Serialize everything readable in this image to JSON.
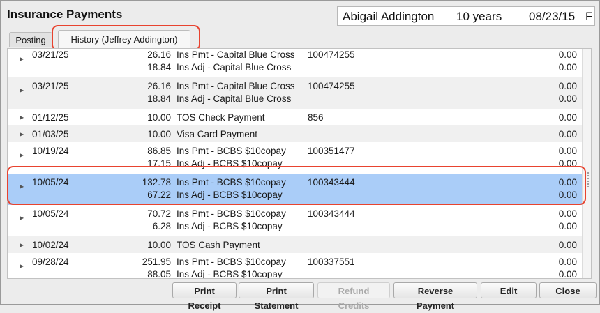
{
  "window": {
    "title": "Insurance Payments"
  },
  "patient": {
    "name": "Abigail Addington",
    "age": "10 years",
    "dob": "08/23/15",
    "sex": "F"
  },
  "tabs": [
    {
      "label": "Posting"
    },
    {
      "label": "History (Jeffrey Addington)"
    }
  ],
  "rows": [
    {
      "date": "03/21/25",
      "lines": [
        {
          "amount": "26.16",
          "desc": "Ins Pmt - Capital Blue Cross",
          "balance": "0.00"
        },
        {
          "amount": "18.84",
          "desc": "Ins Adj - Capital Blue Cross",
          "balance": "0.00"
        }
      ],
      "ref": "100474255"
    },
    {
      "date": "03/21/25",
      "lines": [
        {
          "amount": "26.16",
          "desc": "Ins Pmt - Capital Blue Cross",
          "balance": "0.00"
        },
        {
          "amount": "18.84",
          "desc": "Ins Adj - Capital Blue Cross",
          "balance": "0.00"
        }
      ],
      "ref": "100474255"
    },
    {
      "date": "01/12/25",
      "lines": [
        {
          "amount": "10.00",
          "desc": "TOS Check Payment",
          "balance": "0.00"
        }
      ],
      "ref": "856"
    },
    {
      "date": "01/03/25",
      "lines": [
        {
          "amount": "10.00",
          "desc": "Visa Card Payment",
          "balance": "0.00"
        }
      ],
      "ref": ""
    },
    {
      "date": "10/19/24",
      "lines": [
        {
          "amount": "86.85",
          "desc": "Ins Pmt - BCBS $10copay",
          "balance": "0.00"
        },
        {
          "amount": "17.15",
          "desc": "Ins Adj - BCBS $10copay",
          "balance": "0.00"
        }
      ],
      "ref": "100351477"
    },
    {
      "date": "10/05/24",
      "lines": [
        {
          "amount": "132.78",
          "desc": "Ins Pmt - BCBS $10copay",
          "balance": "0.00"
        },
        {
          "amount": "67.22",
          "desc": "Ins Adj - BCBS $10copay",
          "balance": "0.00"
        }
      ],
      "ref": "100343444",
      "selected": true
    },
    {
      "date": "10/05/24",
      "lines": [
        {
          "amount": "70.72",
          "desc": "Ins Pmt - BCBS $10copay",
          "balance": "0.00"
        },
        {
          "amount": "6.28",
          "desc": "Ins Adj - BCBS $10copay",
          "balance": "0.00"
        }
      ],
      "ref": "100343444"
    },
    {
      "date": "10/02/24",
      "lines": [
        {
          "amount": "10.00",
          "desc": "TOS Cash Payment",
          "balance": "0.00"
        }
      ],
      "ref": ""
    },
    {
      "date": "09/28/24",
      "lines": [
        {
          "amount": "251.95",
          "desc": "Ins Pmt - BCBS $10copay",
          "balance": "0.00"
        },
        {
          "amount": "88.05",
          "desc": "Ins Adj - BCBS $10copay",
          "balance": "0.00"
        }
      ],
      "ref": "100337551"
    }
  ],
  "buttons": {
    "print_receipt": "Print Receipt",
    "print_statement": "Print Statement",
    "refund_credits": "Refund Credits",
    "reverse_payment": "Reverse Payment",
    "edit": "Edit",
    "close": "Close"
  },
  "colors": {
    "selection": "#aacdf8",
    "highlight": "#e8432f"
  }
}
